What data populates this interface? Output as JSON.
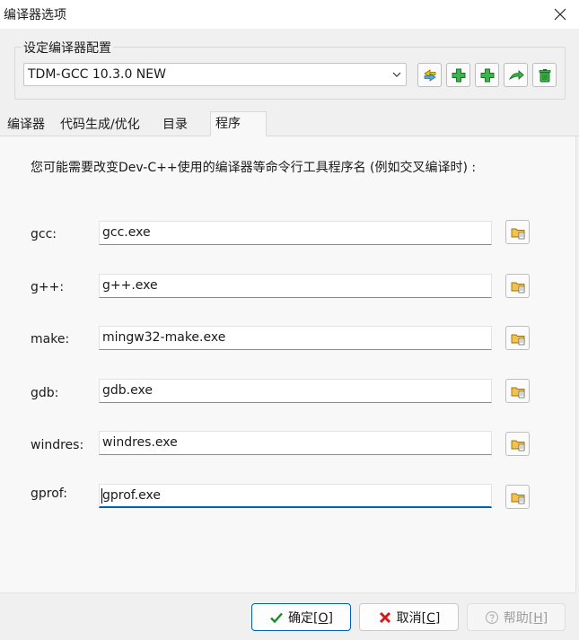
{
  "window": {
    "title": "编译器选项",
    "close_label": "✕"
  },
  "compiler_set": {
    "group_label": "设定编译器配置",
    "selected": "TDM-GCC 10.3.0 NEW",
    "toolbar_icons": [
      "rename-icon",
      "add-icon",
      "add-from-folder-icon",
      "redetect-icon",
      "delete-icon"
    ]
  },
  "tabs": [
    {
      "label": "编译器",
      "active": false
    },
    {
      "label": "代码生成/优化",
      "active": false
    },
    {
      "label": "目录",
      "active": false
    },
    {
      "label": "程序",
      "active": true
    }
  ],
  "programs": {
    "description": "您可能需要改变Dev-C++使用的编译器等命令行工具程序名 (例如交叉编译时) :",
    "rows": [
      {
        "label": "gcc:",
        "value": "gcc.exe"
      },
      {
        "label": "g++:",
        "value": "g++.exe"
      },
      {
        "label": "make:",
        "value": "mingw32-make.exe"
      },
      {
        "label": "gdb:",
        "value": "gdb.exe"
      },
      {
        "label": "windres:",
        "value": "windres.exe"
      },
      {
        "label": "gprof:",
        "value": "gprof.exe"
      }
    ]
  },
  "buttons": {
    "ok": {
      "label": "确定",
      "shortcut": "[O]"
    },
    "cancel": {
      "label": "取消",
      "shortcut": "[C]"
    },
    "help": {
      "label": "帮助",
      "shortcut": "[H]"
    }
  },
  "colors": {
    "accent": "#005fb8",
    "green_icon": "#3bb54a",
    "cancel_red": "#d11a1a"
  }
}
